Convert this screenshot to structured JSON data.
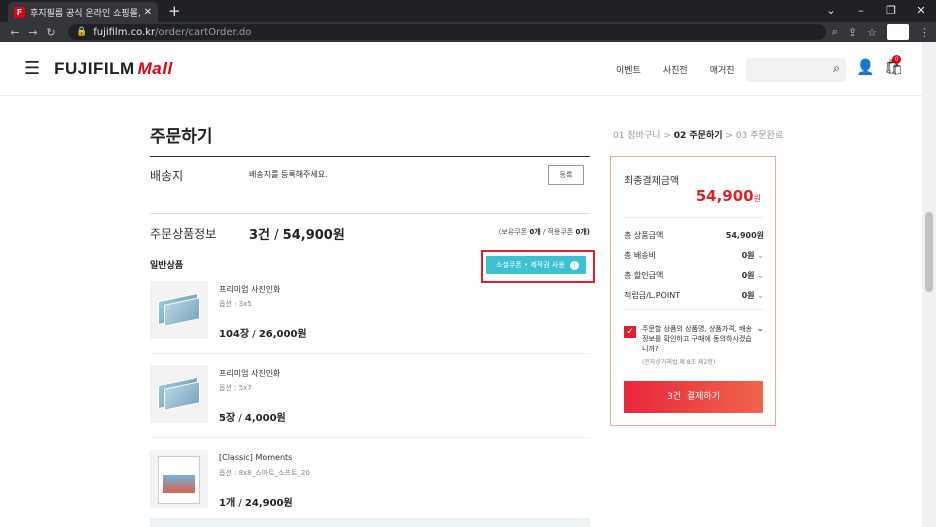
{
  "browser": {
    "tab_title": "후지필름 공식 온라인 쇼핑몰, 후",
    "favicon_text": "F",
    "url_domain": "fujifilm.co.kr",
    "url_path": "/order/cartOrder.do"
  },
  "header": {
    "logo_text": "FUJIFILM",
    "logo_mall": "Mall",
    "nav": [
      "이벤트",
      "사진전",
      "매거진"
    ],
    "cart_count": "0"
  },
  "page": {
    "title": "주문하기",
    "steps": {
      "step1": "01 장바구니",
      "step2": "02 주문하기",
      "step3": "03 주문완료",
      "sep": ">"
    }
  },
  "shipping": {
    "label": "배송지",
    "text": "배송지를 등록해주세요.",
    "register_label": "등록"
  },
  "order_products": {
    "label": "주문상품정보",
    "count": "3건",
    "total": "54,900원",
    "coupon_owned_label": "(보유쿠폰",
    "coupon_owned": "0개",
    "coupon_applied_label": "/ 적용쿠폰",
    "coupon_applied": "0개)",
    "general_label": "일반상품",
    "coupon_button": "소셜쿠폰 • 제작권 사용"
  },
  "items": [
    {
      "name": "프리미엄 사진인화",
      "option": "옵션 : 3x5",
      "qty": "104장",
      "price": "26,000원"
    },
    {
      "name": "프리미엄 사진인화",
      "option": "옵션 : 5x7",
      "qty": "5장",
      "price": "4,000원"
    },
    {
      "name": "[Classic] Moments",
      "option": "옵션 : 8x8_스마트_소프트_20",
      "qty": "1개",
      "price": "24,900원"
    }
  ],
  "summary": {
    "final_title": "최종결제금액",
    "final_amount": "54,900",
    "won": "원",
    "rows": [
      {
        "label": "총 상품금액",
        "value": "54,900원"
      },
      {
        "label": "총 배송비",
        "value": "0원"
      },
      {
        "label": "총 할인금액",
        "value": "0원"
      },
      {
        "label": "적립금/L.POINT",
        "value": "0원"
      }
    ],
    "agree_text": "주문할 상품의 상품명, 상품가격, 배송정보를 확인하고 구매에 동의하시겠습니까?",
    "agree_note": "(전자상거래법 제 8조 제2항)",
    "pay_count": "3건",
    "pay_label": "결제하기"
  },
  "colors": {
    "accent": "#e0202c",
    "coupon": "#3cc1d0"
  }
}
